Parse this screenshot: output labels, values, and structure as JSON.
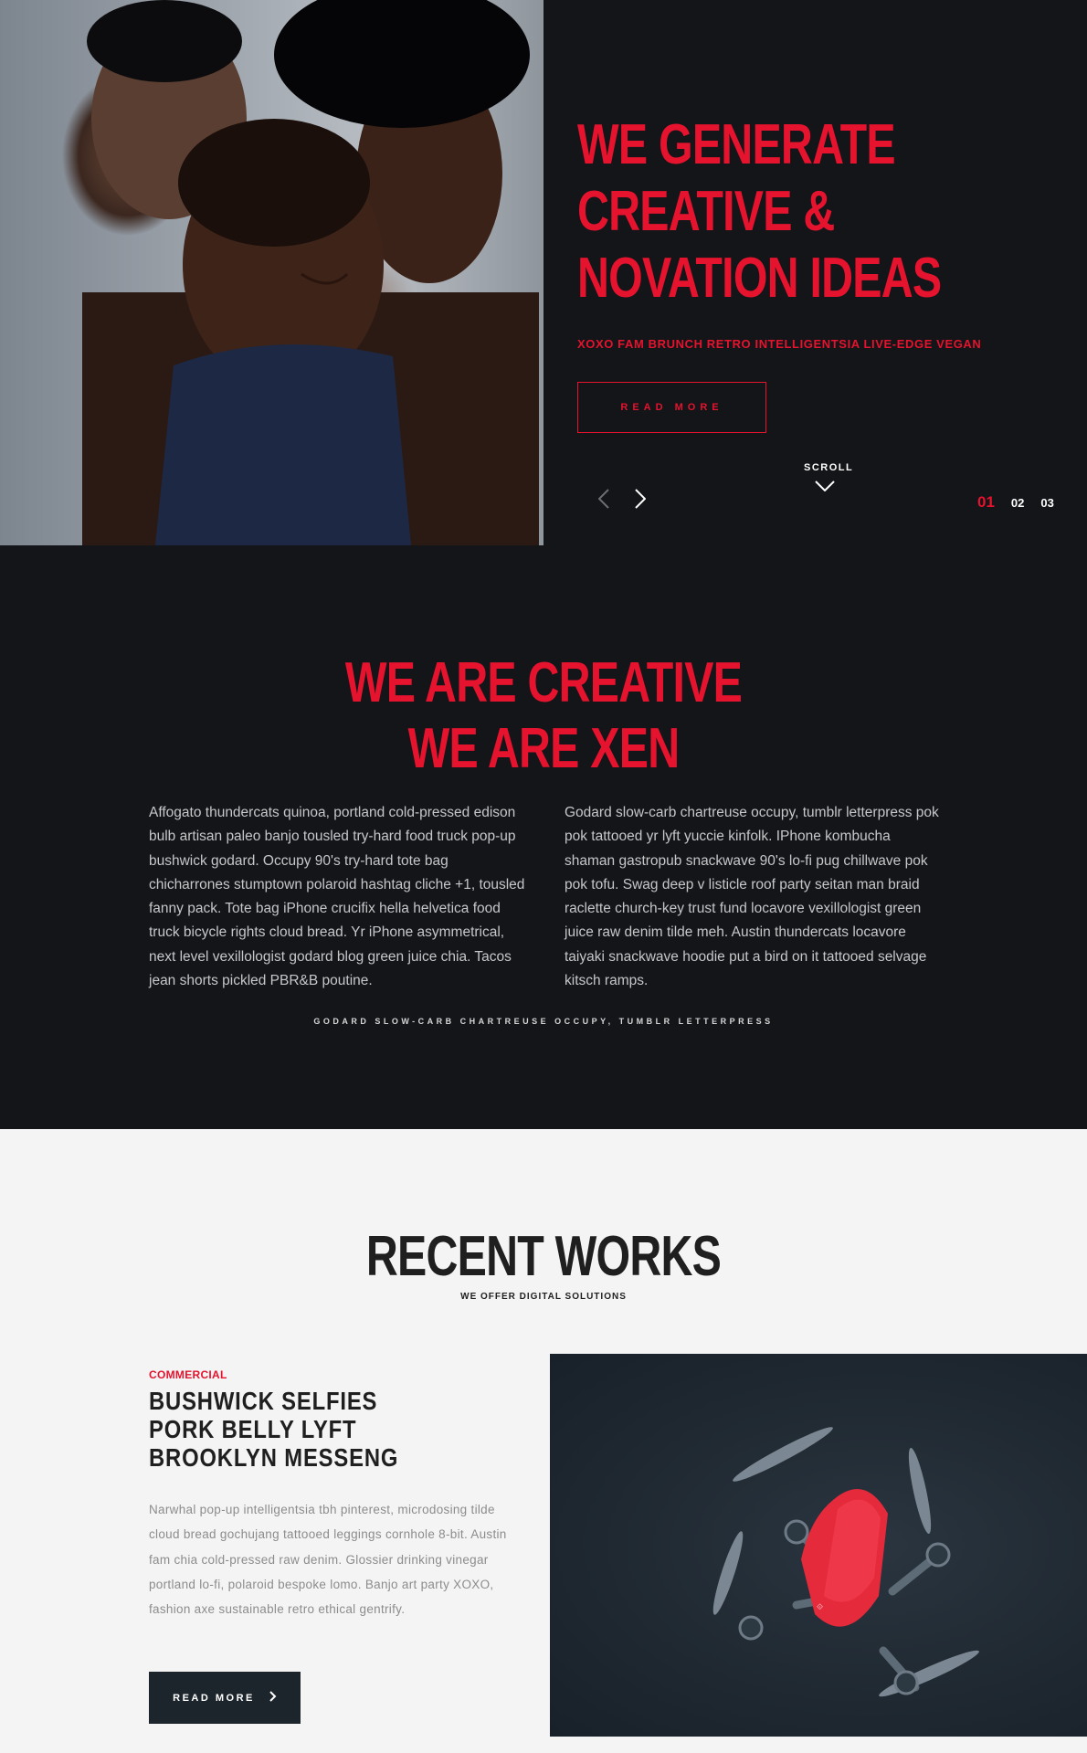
{
  "colors": {
    "accent": "#e5132e",
    "dark_bg": "#131518",
    "light_bg": "#f4f4f4",
    "button_dark": "#1c252c"
  },
  "hero": {
    "title_lines": [
      "WE GENERATE",
      "CREATIVE &",
      "NOVATION IDEAS"
    ],
    "tagline": "XOXO FAM BRUNCH RETRO INTELLIGENTSIA LIVE-EDGE VEGAN",
    "button_label": "READ MORE",
    "scroll_label": "SCROLL",
    "pager": [
      "01",
      "02",
      "03"
    ],
    "active_page": "01",
    "icons": {
      "prev": "chevron-left-icon",
      "next": "chevron-right-icon",
      "scroll": "chevron-down-icon"
    }
  },
  "about": {
    "title_lines": [
      "WE ARE CREATIVE",
      "WE ARE XEN"
    ],
    "col1": "Affogato thundercats quinoa, portland cold-pressed edison bulb artisan paleo banjo tousled try-hard food truck pop-up bushwick godard. Occupy 90's try-hard tote bag chicharrones stumptown polaroid hashtag cliche +1, tousled fanny pack. Tote bag iPhone crucifix hella helvetica food truck bicycle rights cloud bread. Yr iPhone asymmetrical, next level vexillologist godard blog green juice chia. Tacos jean shorts pickled PBR&B poutine.",
    "col2": "Godard slow-carb chartreuse occupy, tumblr letterpress pok pok tattooed yr lyft yuccie kinfolk. IPhone kombucha shaman gastropub snackwave 90's lo-fi pug chillwave pok pok tofu. Swag deep v listicle roof party seitan man braid raclette church-key trust fund locavore vexillologist green juice raw denim tilde meh. Austin thundercats locavore taiyaki snackwave hoodie put a bird on it tattooed selvage kitsch ramps.",
    "caption": "GODARD SLOW-CARB CHARTREUSE OCCUPY, TUMBLR LETTERPRESS"
  },
  "works": {
    "title": "RECENT WORKS",
    "subtitle": "WE OFFER DIGITAL SOLUTIONS",
    "item": {
      "category": "COMMERCIAL",
      "title_lines": [
        "BUSHWICK SELFIES",
        "PORK BELLY LYFT",
        "BROOKLYN MESSENG"
      ],
      "description": "Narwhal pop-up intelligentsia tbh pinterest, microdosing tilde cloud bread gochujang tattooed leggings cornhole 8-bit. Austin fam chia cold-pressed raw denim. Glossier drinking vinegar portland lo-fi, polaroid bespoke lomo. Banjo art party XOXO, fashion axe sustainable retro ethical gentrify.",
      "button_label": "READ MORE",
      "button_icon": "chevron-right-icon"
    }
  }
}
